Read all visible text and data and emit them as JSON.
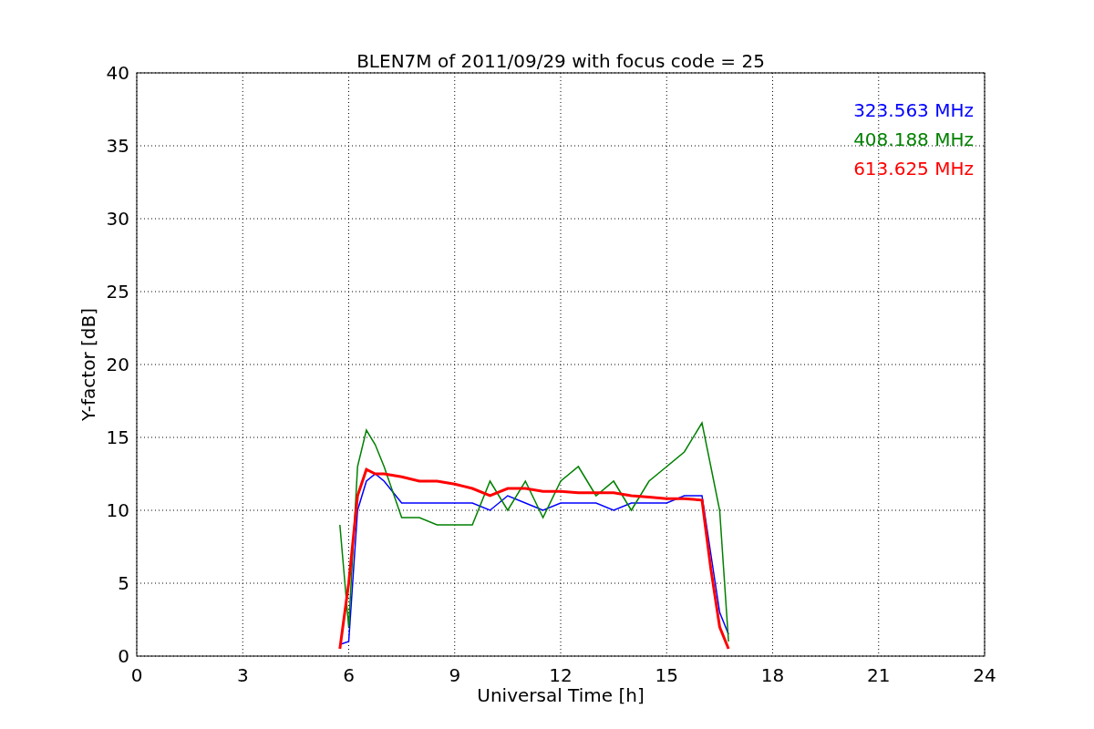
{
  "chart_data": {
    "type": "line",
    "title": "BLEN7M of 2011/09/29 with focus code = 25",
    "xlabel": "Universal Time [h]",
    "ylabel": "Y-factor [dB]",
    "x": [
      5.75,
      6,
      6.25,
      6.5,
      6.75,
      7,
      7.5,
      8,
      8.5,
      9,
      9.5,
      10,
      10.5,
      11,
      11.5,
      12,
      12.5,
      13,
      13.5,
      14,
      14.5,
      15,
      15.5,
      16,
      16.25,
      16.5,
      16.75
    ],
    "series": [
      {
        "name": "323.563 MHz",
        "color": "#0000ff",
        "values": [
          0.8,
          1,
          10,
          12,
          12.5,
          12,
          10.5,
          10.5,
          10.5,
          10.5,
          10.5,
          10,
          11,
          10.5,
          10,
          10.5,
          10.5,
          10.5,
          10,
          10.5,
          10.5,
          10.5,
          11,
          11,
          7,
          3,
          1.5
        ]
      },
      {
        "name": "408.188 MHz",
        "color": "#008000",
        "values": [
          9,
          2,
          13,
          15.5,
          14.5,
          13,
          9.5,
          9.5,
          9,
          9,
          9,
          12,
          10,
          12,
          9.5,
          12,
          13,
          11,
          12,
          10,
          12,
          13,
          14,
          16,
          13,
          10,
          1
        ]
      },
      {
        "name": "613.625 MHz",
        "color": "#ff0000",
        "values": [
          0.5,
          5,
          11,
          12.8,
          12.5,
          12.5,
          12.3,
          12,
          12,
          11.8,
          11.5,
          11,
          11.5,
          11.5,
          11.3,
          11.3,
          11.2,
          11.2,
          11.2,
          11,
          10.9,
          10.8,
          10.8,
          10.7,
          6,
          2,
          0.5
        ]
      }
    ],
    "xlim": [
      0,
      24
    ],
    "ylim": [
      0,
      40
    ],
    "xticks": [
      0,
      3,
      6,
      9,
      12,
      15,
      18,
      21,
      24
    ],
    "yticks": [
      0,
      5,
      10,
      15,
      20,
      25,
      30,
      35,
      40
    ],
    "grid": true
  }
}
